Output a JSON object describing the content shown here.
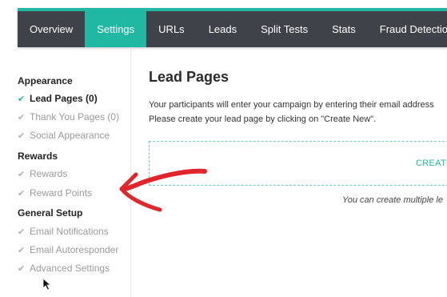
{
  "nav": {
    "tabs": [
      {
        "label": "Overview"
      },
      {
        "label": "Settings"
      },
      {
        "label": "URLs"
      },
      {
        "label": "Leads"
      },
      {
        "label": "Split Tests"
      },
      {
        "label": "Stats"
      },
      {
        "label": "Fraud Detection"
      }
    ],
    "active_tab": "Settings",
    "accent_color": "#20b8a2",
    "bar_color": "#3f4249"
  },
  "sidebar": {
    "groups": [
      {
        "title": "Appearance",
        "items": [
          {
            "label": "Lead Pages (0)",
            "active": true
          },
          {
            "label": "Thank You Pages (0)"
          },
          {
            "label": "Social Appearance"
          }
        ]
      },
      {
        "title": "Rewards",
        "items": [
          {
            "label": "Rewards"
          },
          {
            "label": "Reward Points"
          }
        ]
      },
      {
        "title": "General Setup",
        "items": [
          {
            "label": "Email Notifications"
          },
          {
            "label": "Email Autoresponder"
          },
          {
            "label": "Advanced Settings"
          }
        ]
      }
    ]
  },
  "main": {
    "title": "Lead Pages",
    "description_line1": "Your participants will enter your campaign by entering their email address",
    "description_line2": "Please create your lead page by clicking on \"Create New\".",
    "create_label": "CREATE",
    "note": "You can create multiple le"
  },
  "annotation": {
    "arrow_color": "#e0262b"
  }
}
